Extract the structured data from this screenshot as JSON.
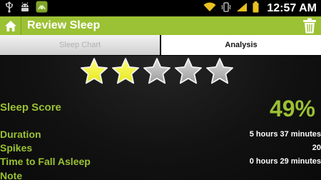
{
  "status_bar": {
    "time": "12:57",
    "ampm": "AM",
    "icons": [
      "usb-icon",
      "android-debug-icon",
      "app-notification-icon",
      "wifi-icon",
      "vibrate-icon",
      "signal-icon",
      "battery-icon",
      "clock-icon"
    ]
  },
  "header": {
    "title": "Review Sleep",
    "home_icon": "home-icon",
    "trash_icon": "trash-icon"
  },
  "tabs": [
    {
      "label": "Sleep Chart",
      "selected": false
    },
    {
      "label": "Analysis",
      "selected": true
    }
  ],
  "rating": {
    "filled": 2,
    "total": 5,
    "filled_color": "#e8e81a",
    "empty_color": "#9a9a9a"
  },
  "analysis": {
    "score_label": "Sleep Score",
    "score_value": "49%",
    "duration_label": "Duration",
    "duration_value": "5 hours 37 minutes",
    "spikes_label": "Spikes",
    "spikes_value": "20",
    "fall_asleep_label": "Time to Fall Asleep",
    "fall_asleep_value": "0 hours 29 minutes",
    "note_label": "Note"
  },
  "colors": {
    "accent": "#9bc134",
    "background": "#0d0d0d"
  }
}
